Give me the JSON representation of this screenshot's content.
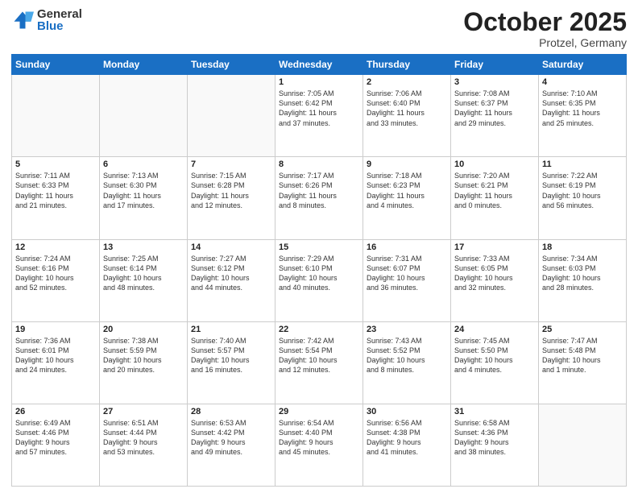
{
  "header": {
    "logo_general": "General",
    "logo_blue": "Blue",
    "month_title": "October 2025",
    "location": "Protzel, Germany"
  },
  "weekdays": [
    "Sunday",
    "Monday",
    "Tuesday",
    "Wednesday",
    "Thursday",
    "Friday",
    "Saturday"
  ],
  "weeks": [
    [
      {
        "day": "",
        "info": ""
      },
      {
        "day": "",
        "info": ""
      },
      {
        "day": "",
        "info": ""
      },
      {
        "day": "1",
        "info": "Sunrise: 7:05 AM\nSunset: 6:42 PM\nDaylight: 11 hours\nand 37 minutes."
      },
      {
        "day": "2",
        "info": "Sunrise: 7:06 AM\nSunset: 6:40 PM\nDaylight: 11 hours\nand 33 minutes."
      },
      {
        "day": "3",
        "info": "Sunrise: 7:08 AM\nSunset: 6:37 PM\nDaylight: 11 hours\nand 29 minutes."
      },
      {
        "day": "4",
        "info": "Sunrise: 7:10 AM\nSunset: 6:35 PM\nDaylight: 11 hours\nand 25 minutes."
      }
    ],
    [
      {
        "day": "5",
        "info": "Sunrise: 7:11 AM\nSunset: 6:33 PM\nDaylight: 11 hours\nand 21 minutes."
      },
      {
        "day": "6",
        "info": "Sunrise: 7:13 AM\nSunset: 6:30 PM\nDaylight: 11 hours\nand 17 minutes."
      },
      {
        "day": "7",
        "info": "Sunrise: 7:15 AM\nSunset: 6:28 PM\nDaylight: 11 hours\nand 12 minutes."
      },
      {
        "day": "8",
        "info": "Sunrise: 7:17 AM\nSunset: 6:26 PM\nDaylight: 11 hours\nand 8 minutes."
      },
      {
        "day": "9",
        "info": "Sunrise: 7:18 AM\nSunset: 6:23 PM\nDaylight: 11 hours\nand 4 minutes."
      },
      {
        "day": "10",
        "info": "Sunrise: 7:20 AM\nSunset: 6:21 PM\nDaylight: 11 hours\nand 0 minutes."
      },
      {
        "day": "11",
        "info": "Sunrise: 7:22 AM\nSunset: 6:19 PM\nDaylight: 10 hours\nand 56 minutes."
      }
    ],
    [
      {
        "day": "12",
        "info": "Sunrise: 7:24 AM\nSunset: 6:16 PM\nDaylight: 10 hours\nand 52 minutes."
      },
      {
        "day": "13",
        "info": "Sunrise: 7:25 AM\nSunset: 6:14 PM\nDaylight: 10 hours\nand 48 minutes."
      },
      {
        "day": "14",
        "info": "Sunrise: 7:27 AM\nSunset: 6:12 PM\nDaylight: 10 hours\nand 44 minutes."
      },
      {
        "day": "15",
        "info": "Sunrise: 7:29 AM\nSunset: 6:10 PM\nDaylight: 10 hours\nand 40 minutes."
      },
      {
        "day": "16",
        "info": "Sunrise: 7:31 AM\nSunset: 6:07 PM\nDaylight: 10 hours\nand 36 minutes."
      },
      {
        "day": "17",
        "info": "Sunrise: 7:33 AM\nSunset: 6:05 PM\nDaylight: 10 hours\nand 32 minutes."
      },
      {
        "day": "18",
        "info": "Sunrise: 7:34 AM\nSunset: 6:03 PM\nDaylight: 10 hours\nand 28 minutes."
      }
    ],
    [
      {
        "day": "19",
        "info": "Sunrise: 7:36 AM\nSunset: 6:01 PM\nDaylight: 10 hours\nand 24 minutes."
      },
      {
        "day": "20",
        "info": "Sunrise: 7:38 AM\nSunset: 5:59 PM\nDaylight: 10 hours\nand 20 minutes."
      },
      {
        "day": "21",
        "info": "Sunrise: 7:40 AM\nSunset: 5:57 PM\nDaylight: 10 hours\nand 16 minutes."
      },
      {
        "day": "22",
        "info": "Sunrise: 7:42 AM\nSunset: 5:54 PM\nDaylight: 10 hours\nand 12 minutes."
      },
      {
        "day": "23",
        "info": "Sunrise: 7:43 AM\nSunset: 5:52 PM\nDaylight: 10 hours\nand 8 minutes."
      },
      {
        "day": "24",
        "info": "Sunrise: 7:45 AM\nSunset: 5:50 PM\nDaylight: 10 hours\nand 4 minutes."
      },
      {
        "day": "25",
        "info": "Sunrise: 7:47 AM\nSunset: 5:48 PM\nDaylight: 10 hours\nand 1 minute."
      }
    ],
    [
      {
        "day": "26",
        "info": "Sunrise: 6:49 AM\nSunset: 4:46 PM\nDaylight: 9 hours\nand 57 minutes."
      },
      {
        "day": "27",
        "info": "Sunrise: 6:51 AM\nSunset: 4:44 PM\nDaylight: 9 hours\nand 53 minutes."
      },
      {
        "day": "28",
        "info": "Sunrise: 6:53 AM\nSunset: 4:42 PM\nDaylight: 9 hours\nand 49 minutes."
      },
      {
        "day": "29",
        "info": "Sunrise: 6:54 AM\nSunset: 4:40 PM\nDaylight: 9 hours\nand 45 minutes."
      },
      {
        "day": "30",
        "info": "Sunrise: 6:56 AM\nSunset: 4:38 PM\nDaylight: 9 hours\nand 41 minutes."
      },
      {
        "day": "31",
        "info": "Sunrise: 6:58 AM\nSunset: 4:36 PM\nDaylight: 9 hours\nand 38 minutes."
      },
      {
        "day": "",
        "info": ""
      }
    ]
  ]
}
